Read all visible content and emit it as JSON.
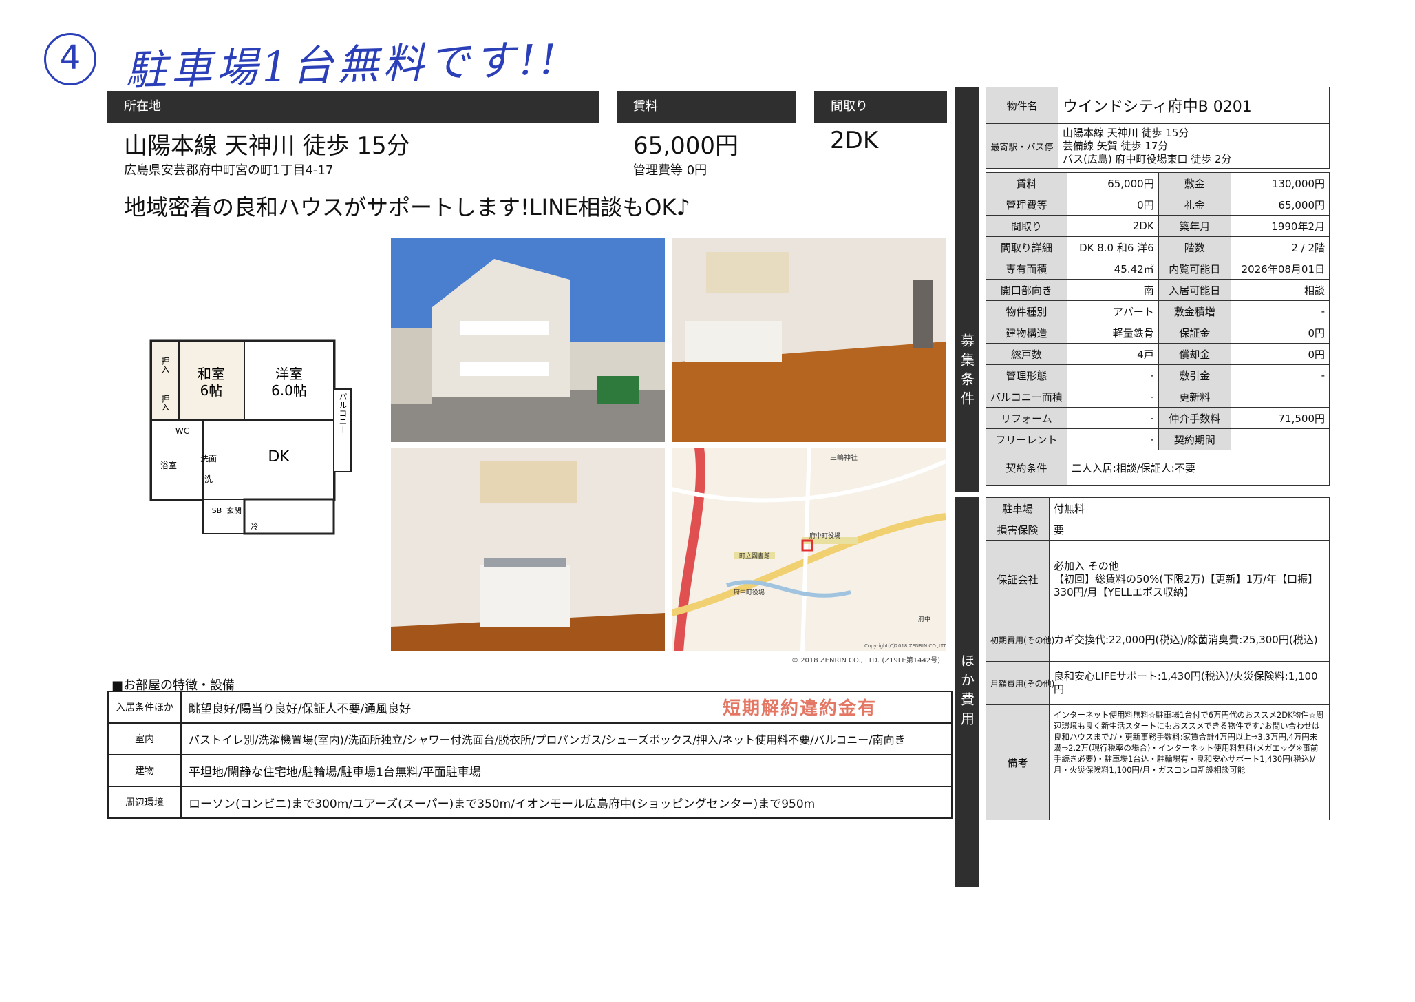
{
  "handwritten": {
    "number": "4",
    "note": "駐車場1台無料です!!"
  },
  "header": {
    "location_label": "所在地",
    "rent_label": "賃料",
    "layout_label": "間取り",
    "access": "山陽本線 天神川 徒歩 15分",
    "address": "広島県安芸郡府中町宮の町1丁目4-17",
    "rent": "65,000円",
    "mgmt_fee": "管理費等 0円",
    "layout": "2DK"
  },
  "tagline": "地域密着の良和ハウスがサポートします!LINE相談もOK♪",
  "floorplan": {
    "oshiire1": "押入",
    "oshiire2": "押入",
    "washitsu": "和室",
    "washitsu_size": "6帖",
    "yoshitsu": "洋室",
    "yoshitsu_size": "6.0帖",
    "balcony": "バルコニー",
    "wc": "WC",
    "bath": "浴室",
    "washroom": "洗面",
    "wash": "洗",
    "sb": "SB",
    "entrance": "玄関",
    "dk": "DK",
    "fridge": "冷"
  },
  "map": {
    "labels": [
      "三嶋神社",
      "府中町役場",
      "町立図書館",
      "府中町役場",
      "府中"
    ],
    "copyright": "Copyright(C)2018 ZENRIN CO.,LTD.",
    "credit": "© 2018 ZENRIN CO., LTD. (Z19LE第1442号)"
  },
  "features": {
    "title": "■お部屋の特徴・設備",
    "rows": [
      {
        "key": "入居条件ほか",
        "value": "眺望良好/陽当り良好/保証人不要/通風良好"
      },
      {
        "key": "室内",
        "value": "バストイレ別/洗濯機置場(室内)/洗面所独立/シャワー付洗面台/脱衣所/プロパンガス/シューズボックス/押入/ネット使用料不要/バルコニー/南向き"
      },
      {
        "key": "建物",
        "value": "平坦地/閑静な住宅地/駐輪場/駐車場1台無料/平面駐車場"
      },
      {
        "key": "周辺環境",
        "value": "ローソン(コンビニ)まで300m/ユアーズ(スーパー)まで350m/イオンモール広島府中(ショッピングセンター)まで950m"
      }
    ],
    "stamp": "短期解約違約金有"
  },
  "details": {
    "property_name_label": "物件名",
    "property_name": "ウインドシティ府中B 0201",
    "station_label": "最寄駅・バス停",
    "station_lines": [
      "山陽本線 天神川 徒歩 15分",
      "芸備線 矢賀 徒歩 17分",
      "バス(広島) 府中町役場東口 徒歩 2分"
    ],
    "section1_label": "募集条件",
    "rows": [
      [
        "賃料",
        "65,000円",
        "敷金",
        "130,000円"
      ],
      [
        "管理費等",
        "0円",
        "礼金",
        "65,000円"
      ],
      [
        "間取り",
        "2DK",
        "築年月",
        "1990年2月"
      ],
      [
        "間取り詳細",
        "DK 8.0 和6 洋6",
        "階数",
        "2 / 2階"
      ],
      [
        "専有面積",
        "45.42㎡",
        "内覧可能日",
        "2026年08月01日"
      ],
      [
        "開口部向き",
        "南",
        "入居可能日",
        "相談"
      ],
      [
        "物件種別",
        "アパート",
        "敷金積増",
        "-"
      ],
      [
        "建物構造",
        "軽量鉄骨",
        "保証金",
        "0円"
      ],
      [
        "総戸数",
        "4戸",
        "償却金",
        "0円"
      ],
      [
        "管理形態",
        "-",
        "敷引金",
        "-"
      ],
      [
        "バルコニー面積",
        "-",
        "更新料",
        ""
      ],
      [
        "リフォーム",
        "-",
        "仲介手数料",
        "71,500円"
      ],
      [
        "フリーレント",
        "-",
        "契約期間",
        ""
      ]
    ],
    "contract_label": "契約条件",
    "contract": "二人入居:相談/保証人:不要",
    "section2_label": "ほか費用",
    "parking_label": "駐車場",
    "parking": "付無料",
    "insurance_label": "損害保険",
    "insurance": "要",
    "guarantor_label": "保証会社",
    "guarantor": "必加入 その他\n【初回】総賃料の50%(下限2万)【更新】1万/年【口振】330円/月【YELLエポス収納】",
    "initial_label": "初期費用(その他)",
    "initial": "カギ交換代:22,000円(税込)/除菌消臭費:25,300円(税込)",
    "monthly_label": "月額費用(その他)",
    "monthly": "良和安心LIFEサポート:1,430円(税込)/火災保険料:1,100円",
    "remarks_label": "備考",
    "remarks": "インターネット使用料無料☆駐車場1台付で6万円代のおススメ2DK物件☆周辺環境も良く新生活スタートにもおススメできる物件です♪お問い合わせは良和ハウスまで♪/・更新事務手数料:家賃合計4万円以上⇒3.3万円,4万円未満⇒2.2万(現行税率の場合)・インターネット使用料無料(メガエッグ※事前手続き必要)・駐車場1台込・駐輪場有・良和安心サポート1,430円(税込)/月・火災保険料1,100円/月・ガスコンロ新設相談可能"
  }
}
